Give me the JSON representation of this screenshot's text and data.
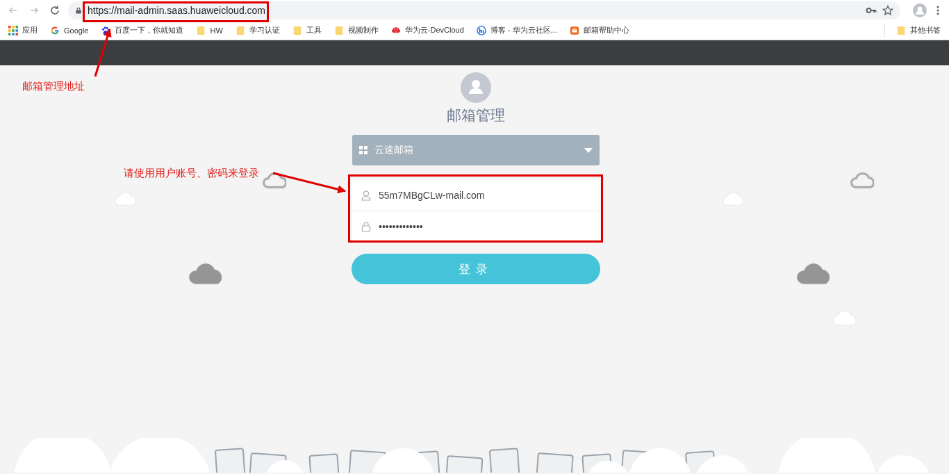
{
  "browser": {
    "back": {
      "disabled": true
    },
    "forward": {
      "disabled": true
    },
    "url": "https://mail-admin.saas.huaweicloud.com",
    "bookmarks": [
      {
        "kind": "apps",
        "label": "应用"
      },
      {
        "kind": "google",
        "label": "Google"
      },
      {
        "kind": "baidu",
        "label": "百度一下，你就知道"
      },
      {
        "kind": "folder",
        "label": "HW"
      },
      {
        "kind": "folder",
        "label": "学习认证"
      },
      {
        "kind": "folder",
        "label": "工具"
      },
      {
        "kind": "folder",
        "label": "视频制作"
      },
      {
        "kind": "huawei",
        "label": "华为云-DevCloud"
      },
      {
        "kind": "blog",
        "label": "博客 - 华为云社区..."
      },
      {
        "kind": "mail",
        "label": "邮箱帮助中心"
      }
    ],
    "other_bookmarks": {
      "kind": "folder",
      "label": "其他书签"
    }
  },
  "login": {
    "title": "邮箱管理",
    "product": "云速邮箱",
    "username": "55m7MBgCLw-mail.com",
    "password": "•••••••••••••",
    "submit": "登录"
  },
  "annotations": [
    {
      "kind": "url",
      "label": "邮箱管理地址"
    },
    {
      "kind": "credentials",
      "label": "请使用用户账号、密码来登录"
    }
  ]
}
